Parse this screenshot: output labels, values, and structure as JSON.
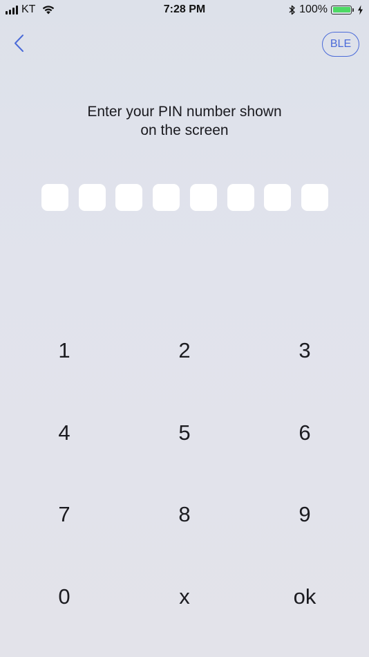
{
  "status_bar": {
    "carrier": "KT",
    "time": "7:28 PM",
    "battery_text": "100%",
    "battery_level": 1.0,
    "icons": [
      "signal-icon",
      "wifi-icon",
      "bluetooth-icon",
      "battery-icon",
      "charging-icon"
    ]
  },
  "nav": {
    "back_icon": "chevron-left-icon",
    "ble_label": "BLE"
  },
  "prompt": {
    "line1": "Enter your PIN number shown",
    "line2": "on the screen"
  },
  "pin": {
    "length": 8,
    "entered": ""
  },
  "keypad": {
    "keys": [
      "1",
      "2",
      "3",
      "4",
      "5",
      "6",
      "7",
      "8",
      "9",
      "0",
      "x",
      "ok"
    ]
  },
  "colors": {
    "accent": "#4a6ad8",
    "background": "#e0e2ea",
    "pin_box": "#ffffff",
    "battery": "#4cd964"
  }
}
